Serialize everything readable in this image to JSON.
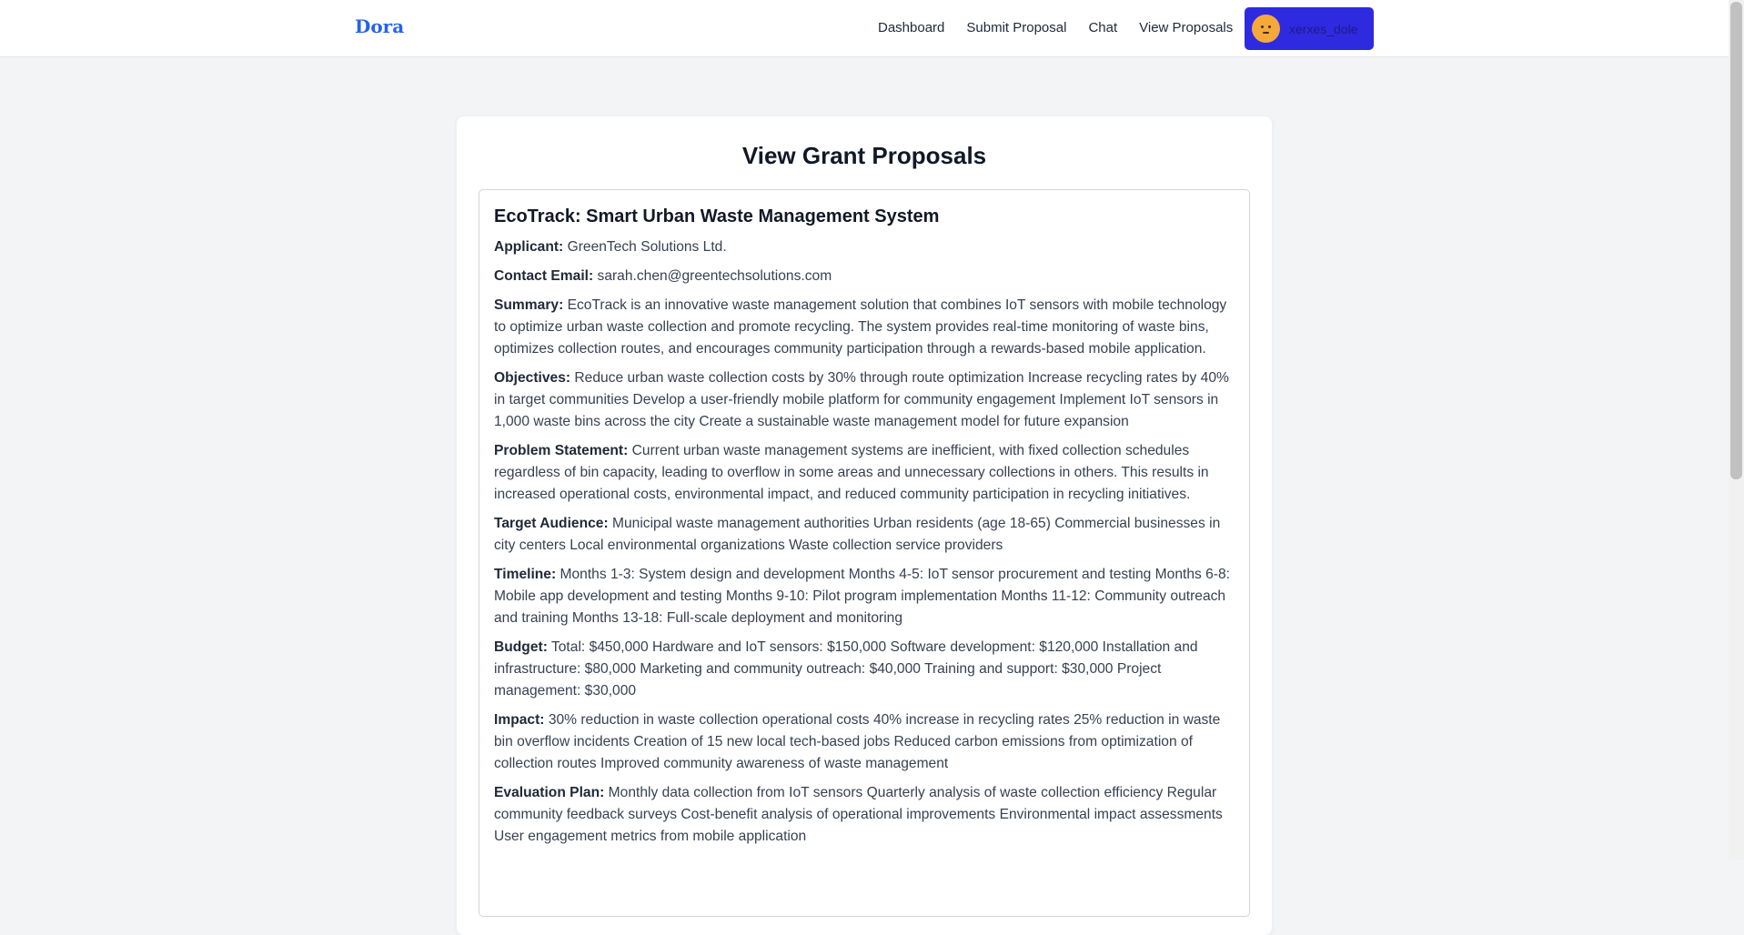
{
  "nav": {
    "brand": "Dora",
    "links": [
      "Dashboard",
      "Submit Proposal",
      "Chat",
      "View Proposals"
    ],
    "user": {
      "name": "xerxes_dole"
    }
  },
  "page": {
    "title": "View Grant Proposals"
  },
  "proposal": {
    "title": "EcoTrack: Smart Urban Waste Management System",
    "fields": [
      {
        "label": "Applicant:",
        "value": "GreenTech Solutions Ltd."
      },
      {
        "label": "Contact Email:",
        "value": "sarah.chen@greentechsolutions.com"
      },
      {
        "label": "Summary:",
        "value": "EcoTrack is an innovative waste management solution that combines IoT sensors with mobile technology to optimize urban waste collection and promote recycling. The system provides real-time monitoring of waste bins, optimizes collection routes, and encourages community participation through a rewards-based mobile application."
      },
      {
        "label": "Objectives:",
        "value": "Reduce urban waste collection costs by 30% through route optimization Increase recycling rates by 40% in target communities Develop a user-friendly mobile platform for community engagement Implement IoT sensors in 1,000 waste bins across the city Create a sustainable waste management model for future expansion"
      },
      {
        "label": "Problem Statement:",
        "value": "Current urban waste management systems are inefficient, with fixed collection schedules regardless of bin capacity, leading to overflow in some areas and unnecessary collections in others. This results in increased operational costs, environmental impact, and reduced community participation in recycling initiatives."
      },
      {
        "label": "Target Audience:",
        "value": "Municipal waste management authorities Urban residents (age 18-65) Commercial businesses in city centers Local environmental organizations Waste collection service providers"
      },
      {
        "label": "Timeline:",
        "value": "Months 1-3: System design and development Months 4-5: IoT sensor procurement and testing Months 6-8: Mobile app development and testing Months 9-10: Pilot program implementation Months 11-12: Community outreach and training Months 13-18: Full-scale deployment and monitoring"
      },
      {
        "label": "Budget:",
        "value": "Total: $450,000 Hardware and IoT sensors: $150,000 Software development: $120,000 Installation and infrastructure: $80,000 Marketing and community outreach: $40,000 Training and support: $30,000 Project management: $30,000"
      },
      {
        "label": "Impact:",
        "value": "30% reduction in waste collection operational costs 40% increase in recycling rates 25% reduction in waste bin overflow incidents Creation of 15 new local tech-based jobs Reduced carbon emissions from optimization of collection routes Improved community awareness of waste management"
      },
      {
        "label": "Evaluation Plan:",
        "value": "Monthly data collection from IoT sensors Quarterly analysis of waste collection efficiency Regular community feedback surveys Cost-benefit analysis of operational improvements Environmental impact assessments User engagement metrics from mobile application"
      }
    ]
  }
}
